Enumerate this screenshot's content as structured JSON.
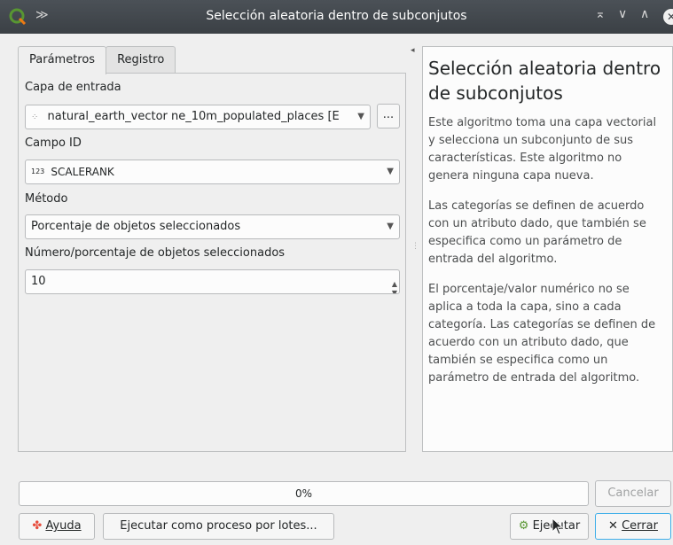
{
  "window": {
    "title": "Selección aleatoria dentro de subconjutos",
    "pin_glyph": "≫",
    "controls": [
      "⌅",
      "∨",
      "∧",
      "✕"
    ]
  },
  "tabs": [
    {
      "label": "Parámetros",
      "active": true
    },
    {
      "label": "Registro",
      "active": false
    }
  ],
  "params": {
    "input_layer": {
      "label": "Capa de entrada",
      "value": "natural_earth_vector ne_10m_populated_places [E",
      "browse_label": "..."
    },
    "id_field": {
      "label": "Campo ID",
      "type_badge": "123",
      "value": "SCALERANK"
    },
    "method": {
      "label": "Método",
      "value": "Porcentaje de objetos seleccionados"
    },
    "number": {
      "label": "Número/porcentaje de objetos seleccionados",
      "value": "10"
    }
  },
  "help": {
    "title": "Selección aleatoria dentro de subconjutos",
    "paragraphs": [
      "Este algoritmo toma una capa vectorial y selecciona un subconjunto de sus características. Este algoritmo no genera ninguna capa nueva.",
      "Las categorías se definen de acuerdo con un atributo dado, que también se especifica como un parámetro de entrada del algoritmo.",
      "El porcentaje/valor numérico no se aplica a toda la capa, sino a cada categoría. Las categorías se definen de acuerdo con un atributo dado, que también se especifica como un parámetro de entrada del algoritmo."
    ]
  },
  "progress": {
    "text": "0%",
    "value": 0
  },
  "buttons": {
    "cancel": "Cancelar",
    "help": "Ayuda",
    "batch": "Ejecutar como proceso por lotes...",
    "run": "Ejecutar",
    "close": "Cerrar"
  },
  "colors": {
    "titlebar": "#3b4045",
    "accent": "#3daee9",
    "qgis_green": "#589632"
  }
}
